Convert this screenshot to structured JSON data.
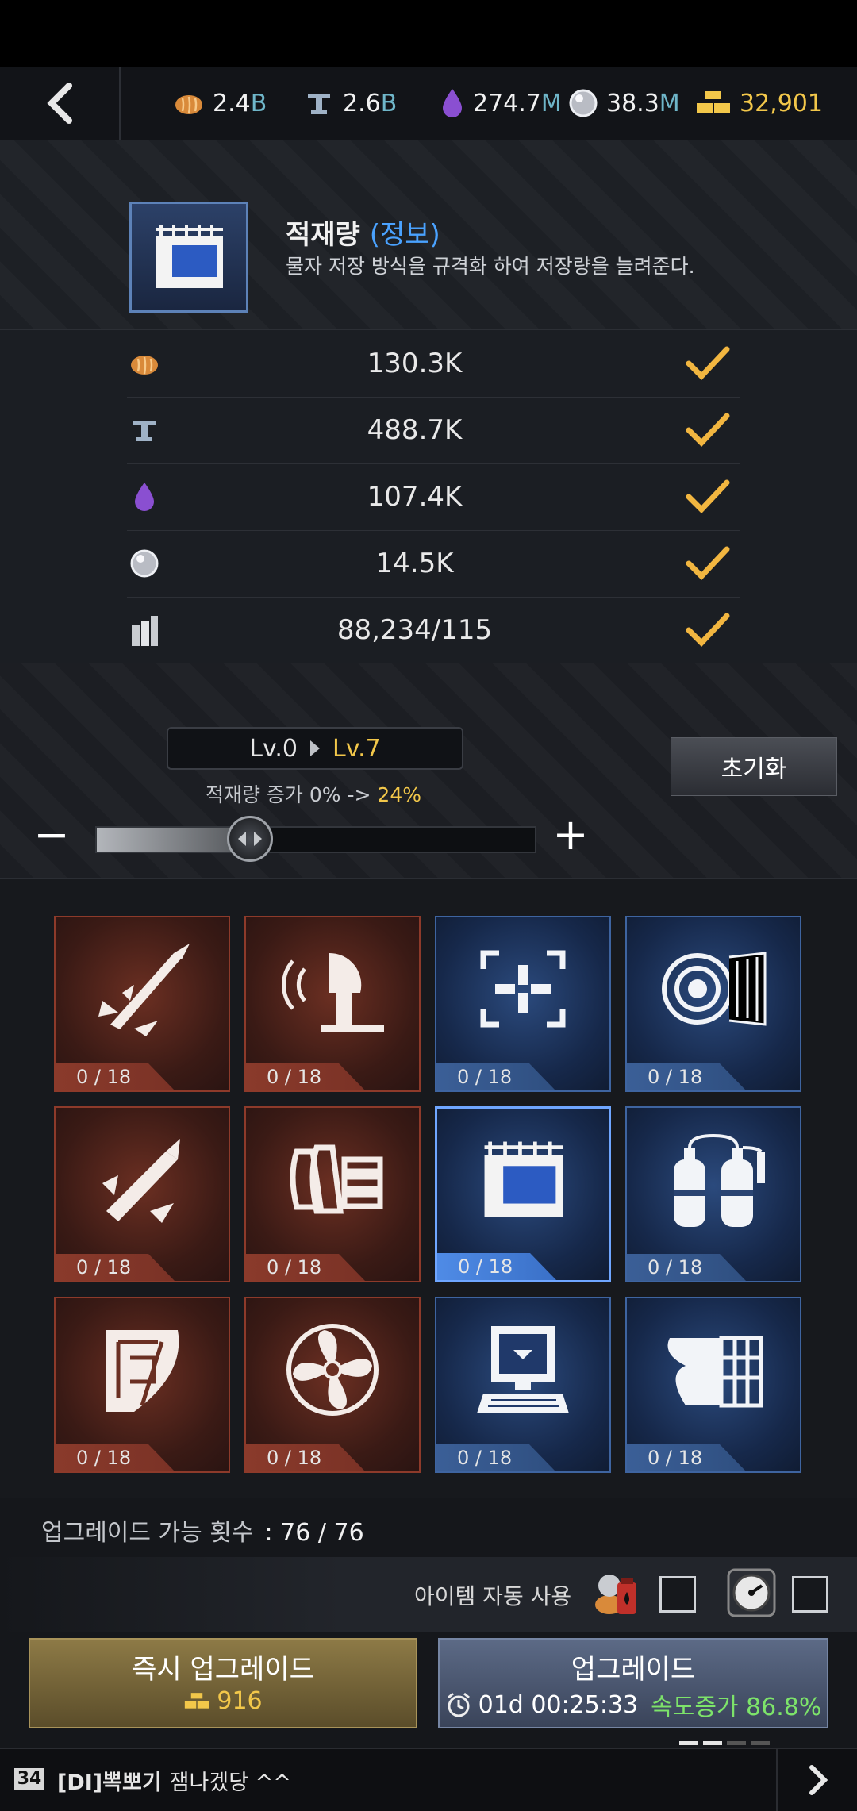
{
  "resources": {
    "food": {
      "num": "2.4",
      "unit": "B"
    },
    "steel": {
      "num": "2.6",
      "unit": "B"
    },
    "oil": {
      "num": "274.7",
      "unit": "M"
    },
    "crystal": {
      "num": "38.3",
      "unit": "M"
    },
    "gold": {
      "num": "32,901"
    }
  },
  "skill": {
    "title": "적재량",
    "info_link": "(정보)",
    "description": "물자 저장 방식을 규격화 하여 저장량을 늘려준다."
  },
  "requirements": [
    {
      "icon": "bread-icon",
      "value": "130.3K"
    },
    {
      "icon": "steel-beam-icon",
      "value": "488.7K"
    },
    {
      "icon": "oil-drop-icon",
      "value": "107.4K"
    },
    {
      "icon": "crystal-orb-icon",
      "value": "14.5K"
    },
    {
      "icon": "canisters-icon",
      "value": "88,234/115"
    }
  ],
  "level": {
    "from": "Lv.0",
    "to": "Lv.7",
    "caption_prefix": "적재량 증가 0% ->",
    "caption_pct": "24%",
    "reset_label": "초기화",
    "slider_fraction": 0.35
  },
  "tiles": [
    {
      "name": "tile-missile-strike",
      "icon": "missile-icon",
      "color": "red",
      "label": "0 / 18"
    },
    {
      "name": "tile-radar",
      "icon": "radar-dish-icon",
      "color": "red",
      "label": "0 / 18"
    },
    {
      "name": "tile-targeting",
      "icon": "crosshair-icon",
      "color": "blue",
      "label": "0 / 18"
    },
    {
      "name": "tile-engine",
      "icon": "jet-engine-icon",
      "color": "blue",
      "label": "0 / 18"
    },
    {
      "name": "tile-torpedo",
      "icon": "torpedo-icon",
      "color": "red",
      "label": "0 / 18"
    },
    {
      "name": "tile-armor-plates",
      "icon": "armor-plates-icon",
      "color": "red",
      "label": "0 / 18"
    },
    {
      "name": "tile-cargo-capacity",
      "icon": "cargo-bay-icon",
      "color": "blue",
      "label": "0 / 18",
      "selected": true
    },
    {
      "name": "tile-gas-tanks",
      "icon": "gas-tanks-icon",
      "color": "blue",
      "label": "0 / 18"
    },
    {
      "name": "tile-hull-plan",
      "icon": "hull-plan-icon",
      "color": "red",
      "label": "0 / 18"
    },
    {
      "name": "tile-propeller",
      "icon": "propeller-icon",
      "color": "red",
      "label": "0 / 18"
    },
    {
      "name": "tile-computer",
      "icon": "computer-icon",
      "color": "blue",
      "label": "0 / 18"
    },
    {
      "name": "tile-hull-grid",
      "icon": "hull-grid-icon",
      "color": "blue",
      "label": "0 / 18"
    }
  ],
  "upgrade_count": {
    "label": "업그레이드 가능 횟수",
    "value": ": 76 / 76"
  },
  "auto_use_label": "아이템 자동 사용",
  "instant_button": {
    "title": "즉시 업그레이드",
    "cost": "916"
  },
  "upgrade_button": {
    "title": "업그레이드",
    "time": "01d 00:25:33",
    "speed": "속도증가 86.8%"
  },
  "chat": {
    "level": "34",
    "sender": "[DI]뽁뽀기",
    "message": "잼나겠당 ^^"
  },
  "colors": {
    "gold": "#f2c74a",
    "accent_blue": "#4aa2ff",
    "speed_green": "#7de36a",
    "check": "#f2b640"
  }
}
